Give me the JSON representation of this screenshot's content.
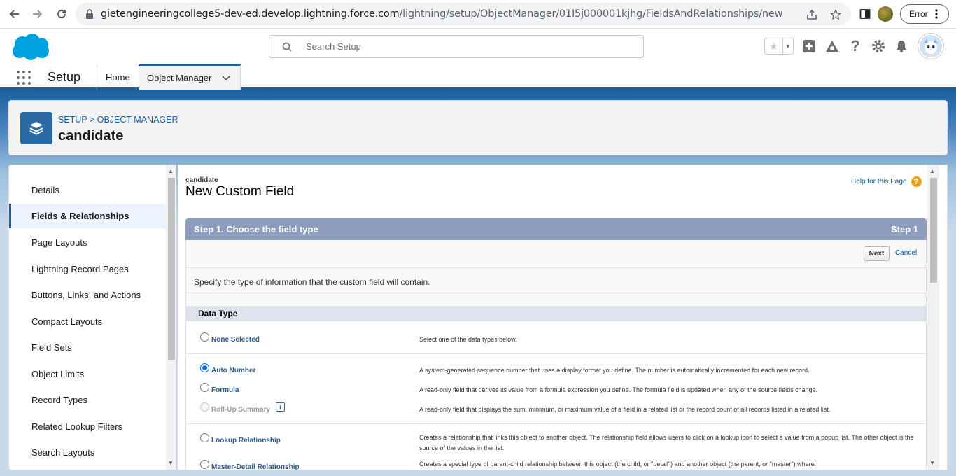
{
  "browser": {
    "url_host": "gietengineeringcollege5-dev-ed.develop.lightning.force.com",
    "url_path": "/lightning/setup/ObjectManager/01I5j000001kjhg/FieldsAndRelationships/new",
    "error_label": "Error"
  },
  "header": {
    "search_placeholder": "Search Setup"
  },
  "nav": {
    "app_name": "Setup",
    "tabs": [
      {
        "label": "Home"
      },
      {
        "label": "Object Manager"
      }
    ]
  },
  "object_header": {
    "breadcrumb_setup": "SETUP",
    "breadcrumb_sep": ">",
    "breadcrumb_om": "OBJECT MANAGER",
    "title": "candidate"
  },
  "sidebar": {
    "items": [
      {
        "label": "Details"
      },
      {
        "label": "Fields & Relationships"
      },
      {
        "label": "Page Layouts"
      },
      {
        "label": "Lightning Record Pages"
      },
      {
        "label": "Buttons, Links, and Actions"
      },
      {
        "label": "Compact Layouts"
      },
      {
        "label": "Field Sets"
      },
      {
        "label": "Object Limits"
      },
      {
        "label": "Record Types"
      },
      {
        "label": "Related Lookup Filters"
      },
      {
        "label": "Search Layouts"
      }
    ]
  },
  "main": {
    "object_name": "candidate",
    "page_title": "New Custom Field",
    "help_link": "Help for this Page",
    "step_title": "Step 1. Choose the field type",
    "step_label": "Step 1",
    "next_label": "Next",
    "cancel_label": "Cancel",
    "instruction": "Specify the type of information that the custom field will contain.",
    "data_type_header": "Data Type",
    "options": [
      {
        "label": "None Selected",
        "desc": "Select one of the data types below."
      },
      {
        "label": "Auto Number",
        "desc": "A system-generated sequence number that uses a display format you define. The number is automatically incremented for each new record."
      },
      {
        "label": "Formula",
        "desc": "A read-only field that derives its value from a formula expression you define. The formula field is updated when any of the source fields change."
      },
      {
        "label": "Roll-Up Summary",
        "desc": "A read-only field that displays the sum, minimum, or maximum value of a field in a related list or the record count of all records listed in a related list."
      },
      {
        "label": "Lookup Relationship",
        "desc": "Creates a relationship that links this object to another object. The relationship field allows users to click on a lookup icon to select a value from a popup list. The other object is the source of the values in the list."
      },
      {
        "label": "Master-Detail Relationship",
        "desc": "Creates a special type of parent-child relationship between this object (the child, or \"detail\") and another object (the parent, or \"master\") where:"
      }
    ],
    "info_glyph": "i"
  },
  "colors": {
    "brand_blue": "#1b5fa0",
    "step_bar": "#8e9dbe",
    "link": "#015ba7"
  }
}
